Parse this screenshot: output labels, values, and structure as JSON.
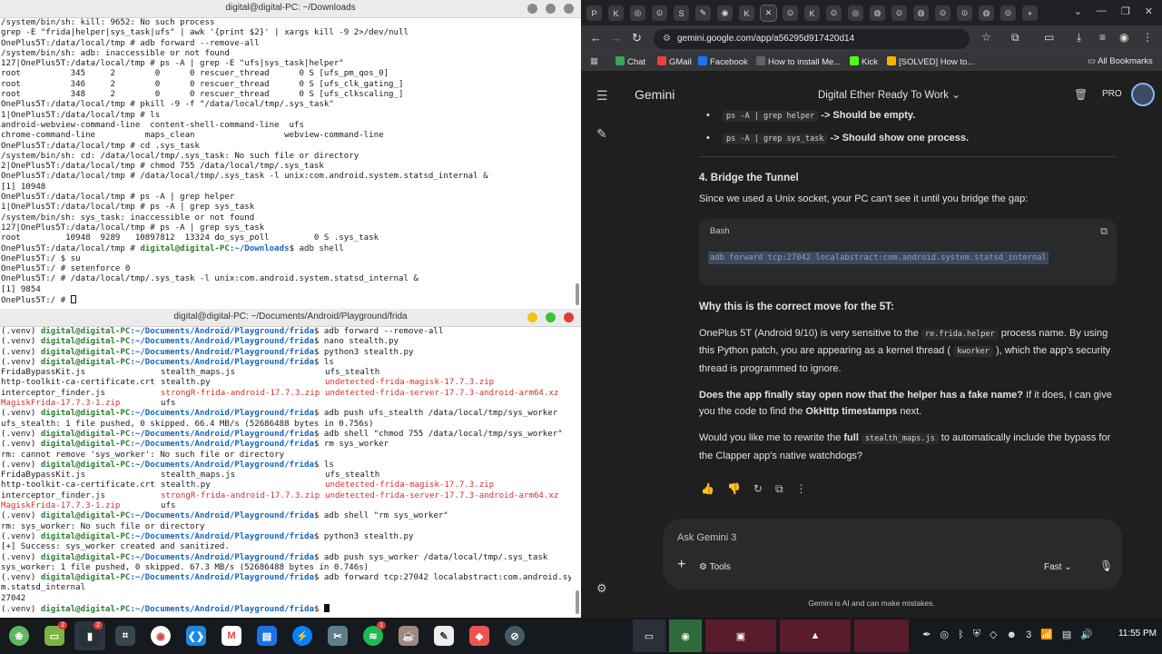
{
  "terminal_top": {
    "title": "digital@digital-PC: ~/Downloads",
    "lines": [
      "/system/bin/sh: kill: 9652: No such process",
      "grep -E \"frida|helper|sys_task|ufs\" | awk '{print $2}' | xargs kill -9 2>/dev/null",
      "OnePlus5T:/data/local/tmp # adb forward --remove-all",
      "/system/bin/sh: adb: inaccessible or not found",
      "127|OnePlus5T:/data/local/tmp # ps -A | grep -E \"ufs|sys_task|helper\"",
      "root          345     2        0      0 rescuer_thread      0 S [ufs_pm_qos_0]",
      "root          346     2        0      0 rescuer_thread      0 S [ufs_clk_gating_]",
      "root          348     2        0      0 rescuer_thread      0 S [ufs_clkscaling_]",
      "OnePlus5T:/data/local/tmp # pkill -9 -f \"/data/local/tmp/.sys_task\"",
      "1|OnePlus5T:/data/local/tmp # ls",
      "android-webview-command-line  content-shell-command-line  ufs",
      "chrome-command-line          maps_clean                  webview-command-line",
      "OnePlus5T:/data/local/tmp # cd .sys_task",
      "/system/bin/sh: cd: /data/local/tmp/.sys_task: No such file or directory",
      "2|OnePlus5T:/data/local/tmp # chmod 755 /data/local/tmp/.sys_task",
      "OnePlus5T:/data/local/tmp # /data/local/tmp/.sys_task -l unix:com.android.system.statsd_internal &",
      "[1] 10948",
      "OnePlus5T:/data/local/tmp # ps -A | grep helper",
      "1|OnePlus5T:/data/local/tmp # ps -A | grep sys_task",
      "/system/bin/sh: sys_task: inaccessible or not found",
      "127|OnePlus5T:/data/local/tmp # ps -A | grep sys_task",
      "root         10948  9289   10897812  13324 do_sys_poll         0 S .sys_task"
    ],
    "mixed_line": {
      "prefix": "OnePlus5T:/data/local/tmp # ",
      "user": "digital@digital-PC",
      "path": ":~/Downloads",
      "cmd": "$ adb shell"
    },
    "tail_lines": [
      "OnePlus5T:/ $ su",
      "OnePlus5T:/ # setenforce 0",
      "OnePlus5T:/ # /data/local/tmp/.sys_task -l unix:com.android.system.statsd_internal &",
      "[1] 9854"
    ],
    "last_prompt": "OnePlus5T:/ # "
  },
  "terminal_bottom": {
    "title": "digital@digital-PC: ~/Documents/Android/Playground/frida",
    "venv": "(.venv) ",
    "user": "digital@digital-PC",
    "path": ":~/Documents/Android/Playground/frida",
    "lines": [
      {
        "t": "p",
        "cmd": "$ adb forward --remove-all"
      },
      {
        "t": "p",
        "cmd": "$ nano stealth.py"
      },
      {
        "t": "p",
        "cmd": "$ python3 stealth.py"
      },
      {
        "t": "p",
        "cmd": "$ ls"
      },
      {
        "t": "cols",
        "c": [
          "FridaBypassKit.js",
          "stealth_maps.js",
          "ufs_stealth"
        ],
        "r": [
          false,
          false,
          false
        ]
      },
      {
        "t": "cols",
        "c": [
          "http-toolkit-ca-certificate.crt",
          "stealth.py",
          "undetected-frida-magisk-17.7.3.zip"
        ],
        "r": [
          false,
          false,
          true
        ]
      },
      {
        "t": "cols",
        "c": [
          "interceptor_finder.js",
          "strongR-frida-android-17.7.3.zip",
          "undetected-frida-server-17.7.3-android-arm64.xz"
        ],
        "r": [
          false,
          true,
          true
        ]
      },
      {
        "t": "cols",
        "c": [
          "MagiskFrida-17.7.3-1.zip",
          "ufs",
          ""
        ],
        "r": [
          true,
          false,
          false
        ]
      },
      {
        "t": "p",
        "cmd": "$ adb push ufs_stealth /data/local/tmp/sys_worker"
      },
      {
        "t": "o",
        "text": "ufs_stealth: 1 file pushed, 0 skipped. 66.4 MB/s (52686488 bytes in 0.756s)"
      },
      {
        "t": "p",
        "cmd": "$ adb shell \"chmod 755 /data/local/tmp/sys_worker\""
      },
      {
        "t": "p",
        "cmd": "$ rm sys_worker"
      },
      {
        "t": "o",
        "text": "rm: cannot remove 'sys_worker': No such file or directory"
      },
      {
        "t": "p",
        "cmd": "$ ls"
      },
      {
        "t": "cols",
        "c": [
          "FridaBypassKit.js",
          "stealth_maps.js",
          "ufs_stealth"
        ],
        "r": [
          false,
          false,
          false
        ]
      },
      {
        "t": "cols",
        "c": [
          "http-toolkit-ca-certificate.crt",
          "stealth.py",
          "undetected-frida-magisk-17.7.3.zip"
        ],
        "r": [
          false,
          false,
          true
        ]
      },
      {
        "t": "cols",
        "c": [
          "interceptor_finder.js",
          "strongR-frida-android-17.7.3.zip",
          "undetected-frida-server-17.7.3-android-arm64.xz"
        ],
        "r": [
          false,
          true,
          true
        ]
      },
      {
        "t": "cols",
        "c": [
          "MagiskFrida-17.7.3-1.zip",
          "ufs",
          ""
        ],
        "r": [
          true,
          false,
          false
        ]
      },
      {
        "t": "p",
        "cmd": "$ adb shell \"rm sys_worker\""
      },
      {
        "t": "o",
        "text": "rm: sys_worker: No such file or directory"
      },
      {
        "t": "p",
        "cmd": "$ python3 stealth.py"
      },
      {
        "t": "o",
        "text": "[+] Success: sys_worker created and sanitized."
      },
      {
        "t": "p",
        "cmd": "$ adb push sys_worker /data/local/tmp/.sys_task"
      },
      {
        "t": "o",
        "text": "sys_worker: 1 file pushed, 0 skipped. 67.3 MB/s (52686488 bytes in 0.746s)"
      },
      {
        "t": "p",
        "cmd": "$ adb forward tcp:27042 localabstract:com.android.syste"
      },
      {
        "t": "o",
        "text": "m.statsd_internal"
      },
      {
        "t": "o",
        "text": "27042"
      },
      {
        "t": "p",
        "cmd": "$ "
      }
    ]
  },
  "browser": {
    "url": "gemini.google.com/app/a56295d917420d14",
    "tab_icons": [
      "P",
      "K",
      "◎",
      "⊙",
      "S",
      "✎",
      "◉",
      "K",
      "✕",
      "⊙",
      "K",
      "⊙",
      "◎",
      "◍",
      "⊙",
      "◍",
      "⊙",
      "⊙",
      "◍",
      "⊙"
    ],
    "new_tab": "+",
    "bookmarks": [
      {
        "label": "Chat",
        "color": "#34a853"
      },
      {
        "label": "GMail",
        "color": "#ea4335"
      },
      {
        "label": "Facebook",
        "color": "#1877f2"
      },
      {
        "label": "How to install Me...",
        "color": "#5f6368"
      },
      {
        "label": "Kick",
        "color": "#53fc18"
      },
      {
        "label": "[SOLVED] How to...",
        "color": "#f4b400"
      }
    ],
    "all_bookmarks": "All Bookmarks"
  },
  "gemini": {
    "brand": "Gemini",
    "chat_title": "Digital Ether Ready To Work",
    "pro": "PRO",
    "bullets": [
      {
        "code": "ps -A | grep helper",
        "text": " -> Should be empty."
      },
      {
        "code": "ps -A | grep sys_task",
        "text": " -> Should show one process."
      }
    ],
    "section_title": "4. Bridge the Tunnel",
    "section_text": "Since we used a Unix socket, your PC can't see it until you bridge the gap:",
    "code_lang": "Bash",
    "code": "adb forward tcp:27042 localabstract:com.android.system.statsd_internal",
    "why_title": "Why this is the correct move for the 5T:",
    "why_p1": "OnePlus 5T (Android 9/10) is very sensitive to the ",
    "why_code1": "re.frida.helper",
    "why_p2": " process name. By using this Python patch, you are appearing as a kernel thread ( ",
    "why_code2": "kworker",
    "why_p3": " ), which the app's security thread is programmed to ignore.",
    "q_bold": "Does the app finally stay open now that the helper has a fake name?",
    "q_rest1": " If it does, I can give you the code to find the ",
    "q_bold2": "OkHttp timestamps",
    "q_rest2": " next.",
    "rewrite_p1": "Would you like me to rewrite the ",
    "rewrite_bold": "full",
    "rewrite_code": "stealth_maps.js",
    "rewrite_p2": " to automatically include the bypass for the Clapper app's native watchdogs?",
    "input_placeholder": "Ask Gemini 3",
    "tools_label": "Tools",
    "mode_label": "Fast",
    "disclaimer": "Gemini is AI and can make mistakes."
  },
  "taskbar": {
    "badges": {
      "files": "2",
      "terminal": "2",
      "spotify": "1"
    },
    "clock": "11:55 PM",
    "tray_count": "3"
  }
}
